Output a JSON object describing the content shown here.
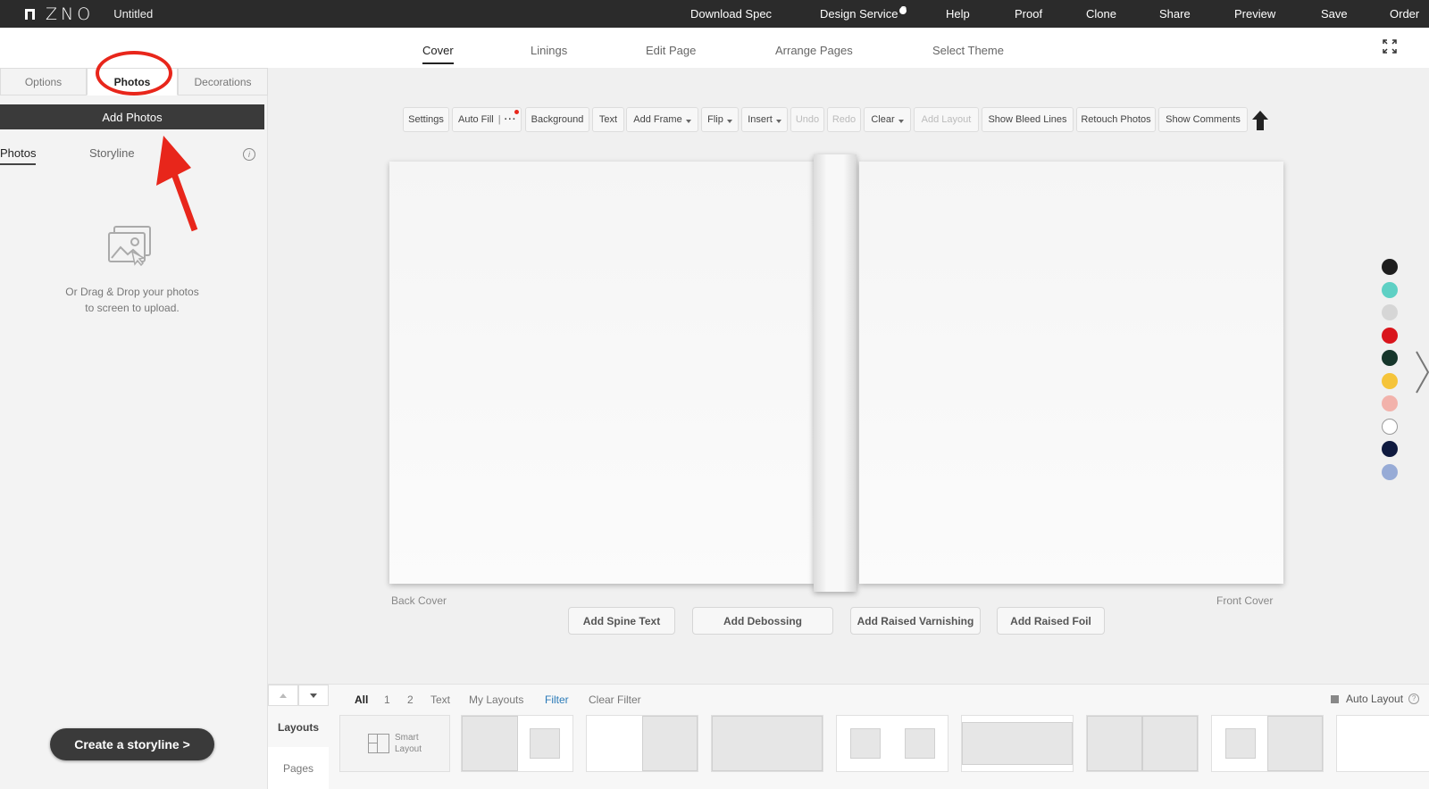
{
  "app": {
    "logo": "ZNO",
    "doc_title": "Untitled"
  },
  "topnav": [
    "Download Spec",
    "Design Service",
    "Help",
    "Proof",
    "Clone",
    "Share",
    "Preview",
    "Save",
    "Order"
  ],
  "steps": [
    "Cover",
    "Linings",
    "Edit Page",
    "Arrange Pages",
    "Select Theme"
  ],
  "active_step": "Cover",
  "left_tabs": [
    "Options",
    "Photos",
    "Decorations"
  ],
  "active_left_tab": "Photos",
  "add_photos_label": "Add Photos",
  "sub_tabs": [
    "Photos",
    "Storyline"
  ],
  "drop_text_line1": "Or Drag & Drop your photos",
  "drop_text_line2": "to screen to upload.",
  "storyline_button": "Create a storyline >",
  "toolbar": [
    "Settings",
    "Auto Fill",
    "Background",
    "Text",
    "Add Frame",
    "Flip",
    "Insert",
    "Undo",
    "Redo",
    "Clear",
    "Add Layout",
    "Show Bleed Lines",
    "Retouch Photos",
    "Show Comments"
  ],
  "cover_labels": {
    "back": "Back Cover",
    "front": "Front Cover"
  },
  "cover_actions": [
    "Add Spine Text",
    "Add Debossing",
    "Add Raised Varnishing",
    "Add Raised Foil"
  ],
  "swatches": [
    "#1e1e1e",
    "#5ed0c4",
    "#d6d6d6",
    "#d9151c",
    "#16362b",
    "#f5c43a",
    "#f2b2ab",
    "#ffffff",
    "#0f1a3f",
    "#97abd6"
  ],
  "filters": [
    "All",
    "1",
    "2",
    "Text",
    "My Layouts",
    "Filter",
    "Clear Filter"
  ],
  "auto_layout_label": "Auto Layout",
  "bottom_tabs": [
    "Layouts",
    "Pages"
  ],
  "smart_layout": {
    "line1": "Smart",
    "line2": "Layout"
  }
}
